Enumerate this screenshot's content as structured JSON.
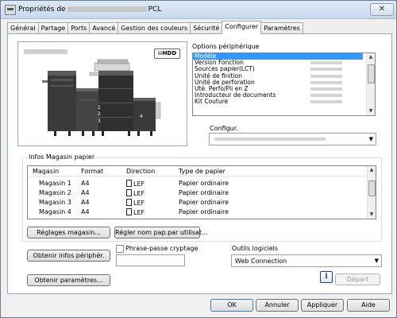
{
  "window": {
    "title_prefix": "Propriétés de",
    "title_suffix": "PCL",
    "close_glyph": "✕"
  },
  "tabs": [
    {
      "label": "Général",
      "active": false
    },
    {
      "label": "Partage",
      "active": false
    },
    {
      "label": "Ports",
      "active": false
    },
    {
      "label": "Avancé",
      "active": false
    },
    {
      "label": "Gestion des couleurs",
      "active": false
    },
    {
      "label": "Sécurité",
      "active": false
    },
    {
      "label": "Configurer",
      "active": true
    },
    {
      "label": "Paramètres",
      "active": false
    }
  ],
  "preview": {
    "hdd_label": "HDD",
    "tray_labels": [
      "1",
      "2",
      "3",
      "4"
    ]
  },
  "options": {
    "group_label": "Options périphérique",
    "items": [
      "Modèle",
      "Version Fonction",
      "Sources papier(LCT)",
      "Unité de finition",
      "Unité de perforation",
      "Uté. Perfo/Pli en Z",
      "Introducteur de documents",
      "Kit Couture"
    ],
    "selected_index": 0,
    "configur_label": "Configur."
  },
  "paper": {
    "group_label": "Infos Magasin papier",
    "columns": [
      "Magasin",
      "Format",
      "Direction",
      "Type de papier"
    ],
    "rows": [
      {
        "magasin": "Magasin 1",
        "format": "A4",
        "direction": "LEF",
        "type": "Papier ordinaire"
      },
      {
        "magasin": "Magasin 2",
        "format": "A4",
        "direction": "LEF",
        "type": "Papier ordinaire"
      },
      {
        "magasin": "Magasin 3",
        "format": "A4",
        "direction": "LEF",
        "type": "Papier ordinaire"
      },
      {
        "magasin": "Magasin 4",
        "format": "A4",
        "direction": "LEF",
        "type": "Papier ordinaire"
      }
    ]
  },
  "buttons": {
    "reglages_magasin": "Réglages magasin...",
    "regler_nom": "Régler nom pap.par utilisat...",
    "obtenir_infos": "Obtenir infos périphér.",
    "obtenir_params": "Obtenir paramètres...",
    "depart": "Départ",
    "ok": "OK",
    "annuler": "Annuler",
    "appliquer": "Appliquer",
    "aide": "Aide"
  },
  "passphrase": {
    "label": "Phrase-passe cryptage",
    "checked": false,
    "value": ""
  },
  "tools": {
    "label": "Outils logiciels",
    "selected": "Web Connection"
  },
  "icons": {
    "info": "i",
    "dropdown": "▼",
    "scroll_up": "▲",
    "scroll_down": "▼"
  },
  "colors": {
    "selection": "#3399ff",
    "window_bg": "#f0f0f0",
    "panel_bg": "#ffffff",
    "printer_body": "#3a3a3a",
    "info_icon": "#1c3f8c"
  }
}
